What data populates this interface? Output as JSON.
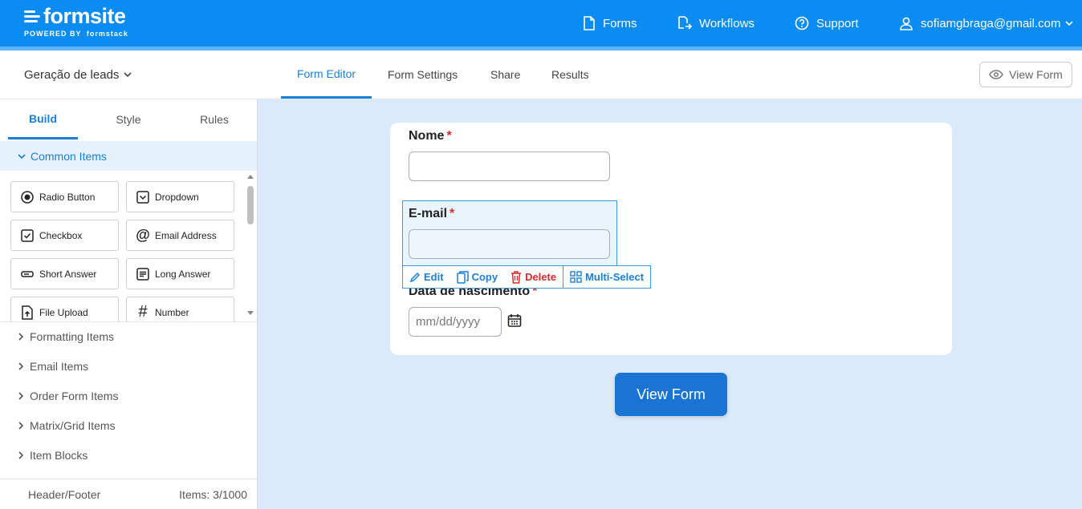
{
  "brand": {
    "name": "formsite",
    "powered_by": "POWERED BY",
    "partner": "formstack"
  },
  "topnav": {
    "forms": "Forms",
    "workflows": "Workflows",
    "support": "Support",
    "user_email": "sofiamgbraga@gmail.com"
  },
  "subheader": {
    "form_name": "Geração de leads",
    "tabs": [
      "Form Editor",
      "Form Settings",
      "Share",
      "Results"
    ],
    "active_tab": "Form Editor",
    "view_form": "View Form"
  },
  "left_panel": {
    "tabs": [
      "Build",
      "Style",
      "Rules"
    ],
    "active_tab": "Build",
    "common_section": "Common Items",
    "items": [
      {
        "label": "Radio Button",
        "icon": "radio-icon"
      },
      {
        "label": "Dropdown",
        "icon": "dropdown-icon"
      },
      {
        "label": "Checkbox",
        "icon": "checkbox-icon"
      },
      {
        "label": "Email Address",
        "icon": "at-icon"
      },
      {
        "label": "Short Answer",
        "icon": "short-answer-icon"
      },
      {
        "label": "Long Answer",
        "icon": "long-answer-icon"
      },
      {
        "label": "File Upload",
        "icon": "file-upload-icon"
      },
      {
        "label": "Number",
        "icon": "hash-icon"
      }
    ],
    "sections": [
      "Formatting Items",
      "Email Items",
      "Order Form Items",
      "Matrix/Grid Items",
      "Item Blocks"
    ],
    "footer_left": "Header/Footer",
    "footer_right": "Items: 3/1000"
  },
  "form": {
    "fields": [
      {
        "label": "Nome",
        "required_mark": "*"
      },
      {
        "label": "E-mail",
        "required_mark": "*"
      },
      {
        "label": "Data de nascimento",
        "required_mark": "*",
        "placeholder": "mm/dd/yyyy"
      }
    ],
    "toolbar": {
      "edit": "Edit",
      "copy": "Copy",
      "delete": "Delete",
      "multi_select": "Multi-Select"
    },
    "view_form_button": "View Form"
  },
  "colors": {
    "topbar": "#0a8cf2",
    "accent": "#1a7fd6",
    "danger": "#d92b2b",
    "canvas": "#dbeafb"
  }
}
